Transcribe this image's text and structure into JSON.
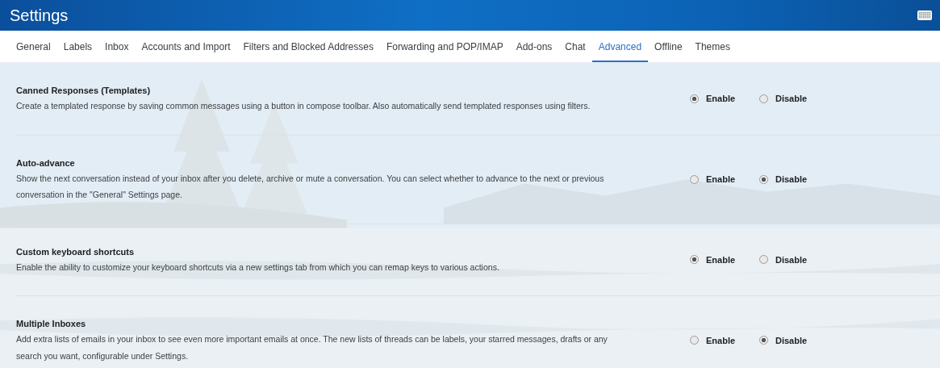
{
  "header": {
    "title": "Settings"
  },
  "tabs": [
    {
      "label": "General",
      "selected": false
    },
    {
      "label": "Labels",
      "selected": false
    },
    {
      "label": "Inbox",
      "selected": false
    },
    {
      "label": "Accounts and Import",
      "selected": false
    },
    {
      "label": "Filters and Blocked Addresses",
      "selected": false
    },
    {
      "label": "Forwarding and POP/IMAP",
      "selected": false
    },
    {
      "label": "Add-ons",
      "selected": false
    },
    {
      "label": "Chat",
      "selected": false
    },
    {
      "label": "Advanced",
      "selected": true
    },
    {
      "label": "Offline",
      "selected": false
    },
    {
      "label": "Themes",
      "selected": false
    }
  ],
  "settings": [
    {
      "title": "Canned Responses (Templates)",
      "description": "Create a templated response by saving common messages using a button in compose toolbar. Also automatically send templated responses using filters.",
      "options": [
        {
          "label": "Enable",
          "selected": true
        },
        {
          "label": "Disable",
          "selected": false
        }
      ]
    },
    {
      "title": "Auto-advance",
      "description": "Show the next conversation instead of your inbox after you delete, archive or mute a conversation. You can select whether to advance to the next or previous conversation in the \"General\" Settings page.",
      "options": [
        {
          "label": "Enable",
          "selected": false
        },
        {
          "label": "Disable",
          "selected": true
        }
      ]
    },
    {
      "title": "Custom keyboard shortcuts",
      "description": "Enable the ability to customize your keyboard shortcuts via a new settings tab from which you can remap keys to various actions.",
      "options": [
        {
          "label": "Enable",
          "selected": true
        },
        {
          "label": "Disable",
          "selected": false
        }
      ]
    },
    {
      "title": "Multiple Inboxes",
      "description": "Add extra lists of emails in your inbox to see even more important emails at once. The new lists of threads can be labels, your starred messages, drafts or any search you want, configurable under Settings.",
      "options": [
        {
          "label": "Enable",
          "selected": false
        },
        {
          "label": "Disable",
          "selected": true
        }
      ]
    }
  ]
}
